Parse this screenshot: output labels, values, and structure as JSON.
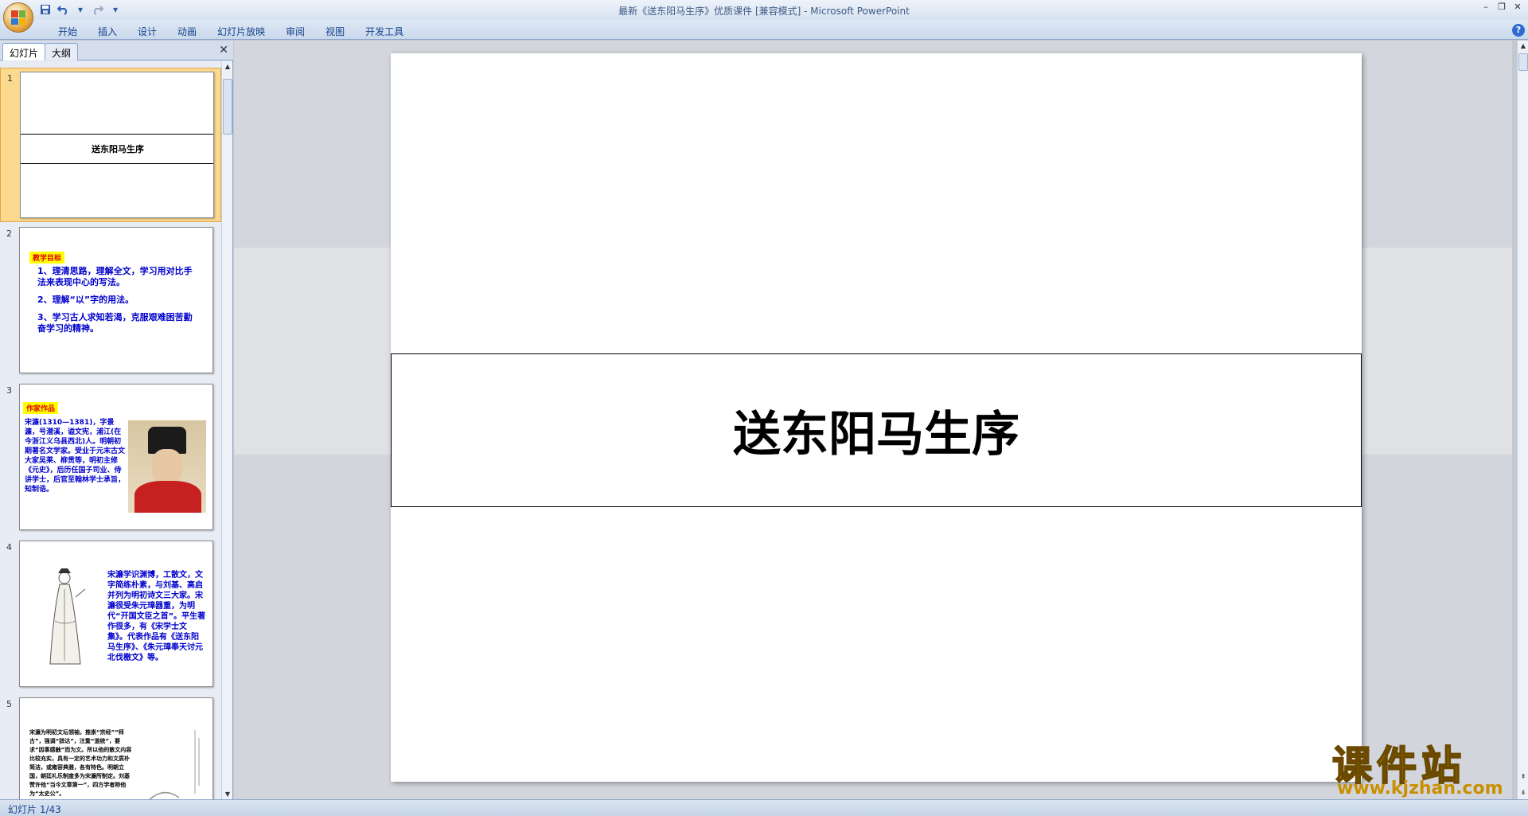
{
  "window": {
    "title": "最新《送东阳马生序》优质课件 [兼容模式] - Microsoft PowerPoint",
    "controls": [
      "–",
      "❐",
      "✕"
    ]
  },
  "quick_access": {
    "save_icon": "save-icon",
    "undo_icon": "undo-icon",
    "redo_icon": "redo-icon",
    "customize_icon": "customize-icon"
  },
  "ribbon": {
    "tabs": [
      "开始",
      "插入",
      "设计",
      "动画",
      "幻灯片放映",
      "审阅",
      "视图",
      "开发工具"
    ],
    "help": "?"
  },
  "left_pane": {
    "tab_slides": "幻灯片",
    "tab_outline": "大纲",
    "close": "✕"
  },
  "thumbnails": [
    {
      "num": "1",
      "title": "送东阳马生序"
    },
    {
      "num": "2",
      "label": "教学目标",
      "lines": [
        "1、理清思路，理解全文，学习用对比手法来表现中心的写法。",
        "2、理解“以”字的用法。",
        "3、学习古人求知若渴，克服艰难困苦勤奋学习的精神。"
      ]
    },
    {
      "num": "3",
      "label": "作家作品",
      "text": "宋濂(1310—1381)，字景濂，号潜溪，谥文宪，浦江(在今浙江义乌县西北)人。明朝初期著名文学家。受业于元末古文大家吴莱、柳贯等，明初主修《元史》，后历任国子司业、侍讲学士，后官至翰林学士承旨，知制诰。"
    },
    {
      "num": "4",
      "text": "宋濂学识渊博，工散文，文字简练朴素，与刘基、高启并列为明初诗文三大家。宋濂很受朱元璋器重，为明代“开国文臣之首”。平生著作很多，有《宋学士文集》。代表作品有《送东阳马生序》、《朱元璋奉天讨元北伐檄文》等。"
    },
    {
      "num": "5",
      "text": "宋濂为明初文坛领袖，推崇“宗经”“师古”，强调“辞达”，注重“道统”，要求“因事感触”而为文。所以他的散文内容比较充实，具有一定的艺术功力和文质朴简洁，或雍容典雅，各有特色。明朝立国，朝廷礼乐制度多为宋濂所制定。刘基赞许他“当今文章第一”，四方学者称他为“太史公”。"
    }
  ],
  "slide": {
    "title": "送东阳马生序"
  },
  "status": {
    "slide_counter": "幻灯片 1/43"
  },
  "watermark": {
    "main": "课件站",
    "url": "www.kjzhan.com"
  },
  "colors": {
    "ribbon": "#dfe8f5",
    "selection": "#fbd98f",
    "thumb_text_blue": "#0000cc",
    "highlight": "#ffff00"
  }
}
